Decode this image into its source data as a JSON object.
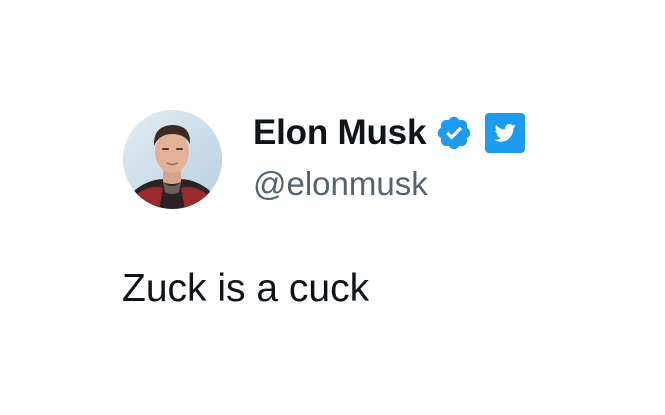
{
  "author": {
    "display_name": "Elon Musk",
    "handle": "@elonmusk",
    "verified_icon": "verified-badge-icon",
    "platform_icon": "twitter-bird-icon"
  },
  "tweet": {
    "text": "Zuck is a cuck"
  },
  "colors": {
    "background": "#ffffff",
    "name_text": "#0f1419",
    "handle_text": "#536471",
    "verified_blue": "#1d9bf0",
    "twitter_blue": "#1d9bf0"
  }
}
